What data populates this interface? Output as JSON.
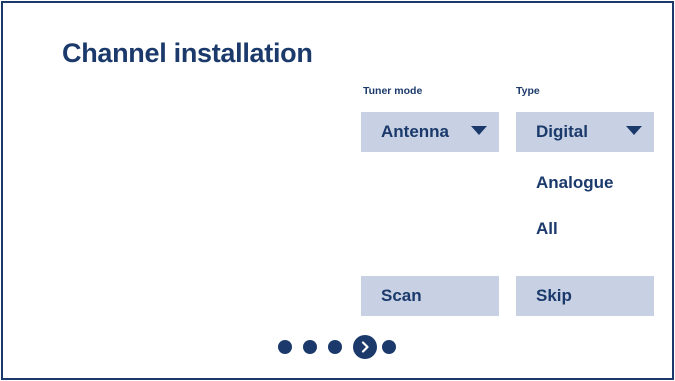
{
  "title": "Channel installation",
  "tuner_mode": {
    "label": "Tuner mode",
    "selected": "Antenna"
  },
  "type": {
    "label": "Type",
    "selected": "Digital",
    "options": [
      "Analogue",
      "All"
    ]
  },
  "buttons": {
    "scan": "Scan",
    "skip": "Skip"
  },
  "pagination": {
    "total_steps": 5,
    "current_step": 4
  },
  "colors": {
    "primary": "#1b3a6b",
    "control_bg": "#c8d1e3",
    "background": "#ffffff"
  }
}
